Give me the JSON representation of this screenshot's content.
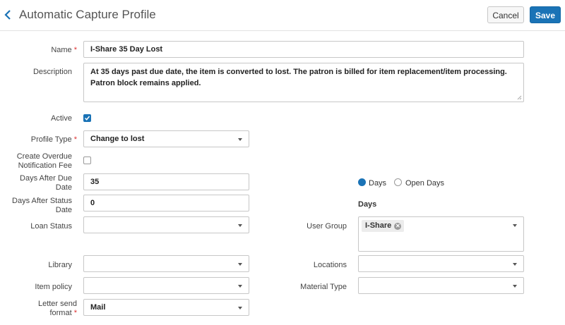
{
  "header": {
    "title": "Automatic Capture Profile",
    "cancel_label": "Cancel",
    "save_label": "Save"
  },
  "form": {
    "name": {
      "label": "Name",
      "required": "*",
      "value": "I-Share 35 Day Lost"
    },
    "description": {
      "label": "Description",
      "value": "At 35 days past due date, the item is converted to lost. The patron is billed for item replacement/item processing. Patron block remains applied."
    },
    "active": {
      "label": "Active",
      "checked": true
    },
    "profile_type": {
      "label": "Profile Type",
      "required": "*",
      "value": "Change to lost"
    },
    "create_overdue_fee": {
      "label_line1": "Create Overdue",
      "label_line2": "Notification Fee",
      "checked": false
    },
    "days_after_due_date": {
      "label_line1": "Days After Due",
      "label_line2": "Date",
      "value": "35"
    },
    "days_after_status_date": {
      "label_line1": "Days After Status",
      "label_line2": "Date",
      "value": "0"
    },
    "days_mode": {
      "options": [
        "Days",
        "Open Days"
      ],
      "selected": "Days"
    },
    "days_unit_label": "Days",
    "loan_status": {
      "label": "Loan Status",
      "value": ""
    },
    "user_group": {
      "label": "User Group",
      "chips": [
        "I-Share"
      ]
    },
    "library": {
      "label": "Library",
      "value": ""
    },
    "locations": {
      "label": "Locations",
      "value": ""
    },
    "item_policy": {
      "label": "Item policy",
      "value": ""
    },
    "material_type": {
      "label": "Material Type",
      "value": ""
    },
    "letter_send_format": {
      "label_line1": "Letter send",
      "label_line2": "format",
      "required": "*",
      "value": "Mail"
    }
  },
  "colors": {
    "accent": "#1a73b6",
    "required": "#d33333"
  }
}
